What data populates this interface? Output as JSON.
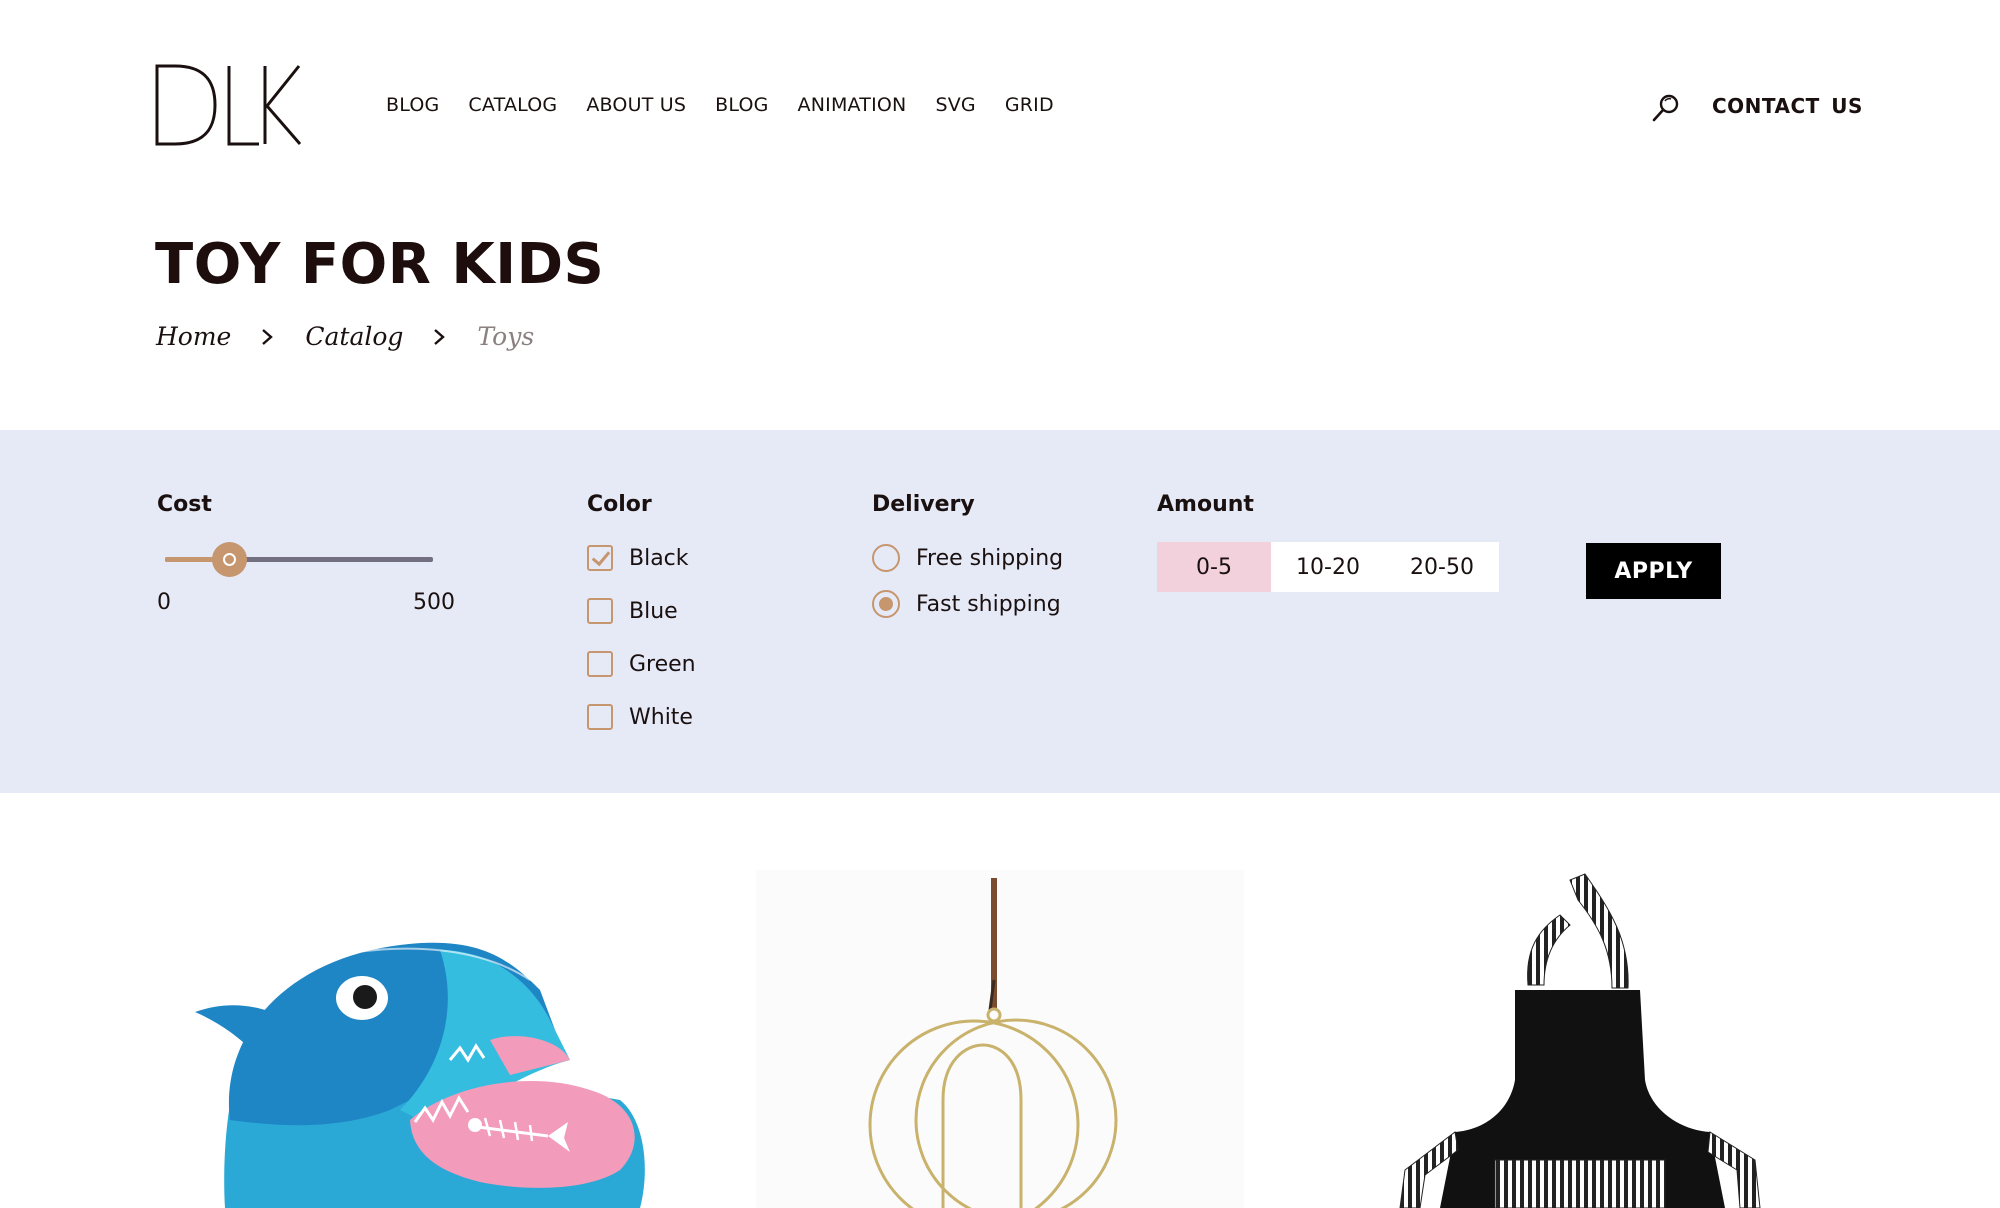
{
  "header": {
    "logo_text": "DLK",
    "nav": [
      "BLOG",
      "CATALOG",
      "ABOUT US",
      "BLOG",
      "ANIMATION",
      "SVG",
      "GRID"
    ],
    "contact_label": "CONTACT  US"
  },
  "page": {
    "title": "TOY FOR KIDS",
    "breadcrumb": [
      "Home",
      "Catalog",
      "Toys"
    ]
  },
  "filters": {
    "cost": {
      "title": "Cost",
      "min_label": "0",
      "max_label": "500",
      "value_fraction": 0.24
    },
    "color": {
      "title": "Color",
      "options": [
        {
          "label": "Black",
          "checked": true
        },
        {
          "label": "Blue",
          "checked": false
        },
        {
          "label": "Green",
          "checked": false
        },
        {
          "label": "White",
          "checked": false
        }
      ]
    },
    "delivery": {
      "title": "Delivery",
      "options": [
        {
          "label": "Free shipping",
          "selected": false
        },
        {
          "label": "Fast shipping",
          "selected": true
        }
      ]
    },
    "amount": {
      "title": "Amount",
      "options": [
        "0-5",
        "10-20",
        "20-50"
      ],
      "active": "0-5"
    },
    "apply_label": "APPLY"
  },
  "colors": {
    "accent": "#c6966e",
    "filter_bg": "#e6eaf7",
    "amount_active": "#f2d1dd",
    "text": "#1a1010"
  },
  "products": [
    {
      "icon": "shark-bean-bag-image"
    },
    {
      "icon": "gold-ring-hanging-image"
    },
    {
      "icon": "black-striped-apron-image"
    }
  ]
}
